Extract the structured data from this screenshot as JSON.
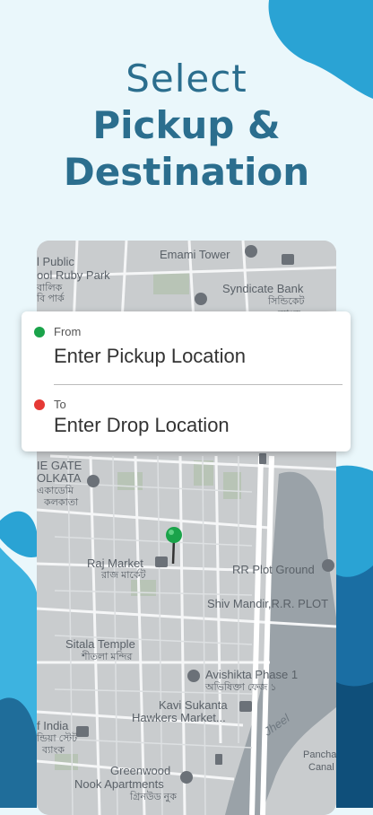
{
  "headline": {
    "line1": "Select",
    "line2": "Pickup &",
    "line3": "Destination"
  },
  "card": {
    "from_label": "From",
    "from_placeholder": "Enter Pickup Location",
    "to_label": "To",
    "to_placeholder": "Enter Drop Location",
    "from_color": "#1aa34a",
    "to_color": "#e53935"
  },
  "map_labels": [
    "Emami Tower",
    "Syndicate Bank",
    "সিন্ডিকেট",
    "ব্যাংক",
    "l Public",
    "ool Ruby Park",
    "বালিক",
    "বি পার্ক",
    "IE GATE",
    "OLKATA",
    "একাডেমি",
    "কলকাতা",
    "Raj Market",
    "রাজ মার্কেট",
    "RR Plot Ground",
    "Shiv Mandir,R.R. PLOT",
    "Sitala Temple",
    "শীতলা মন্দির",
    "Avishikta Phase 1",
    "অভিষিক্তা ফেজ ১",
    "Kavi Sukanta",
    "Hawkers Market...",
    "f India",
    "ন্ডিয়া স্টেট",
    "ব্যাংক",
    "Jheel",
    "Panchanan",
    "Canal",
    "Greenwood",
    "Nook Apartments",
    "গ্রিনউড নুক"
  ],
  "colors": {
    "accent": "#2b6e8e",
    "blob": "#2aa3d4",
    "map_bg": "#c9ccce"
  }
}
